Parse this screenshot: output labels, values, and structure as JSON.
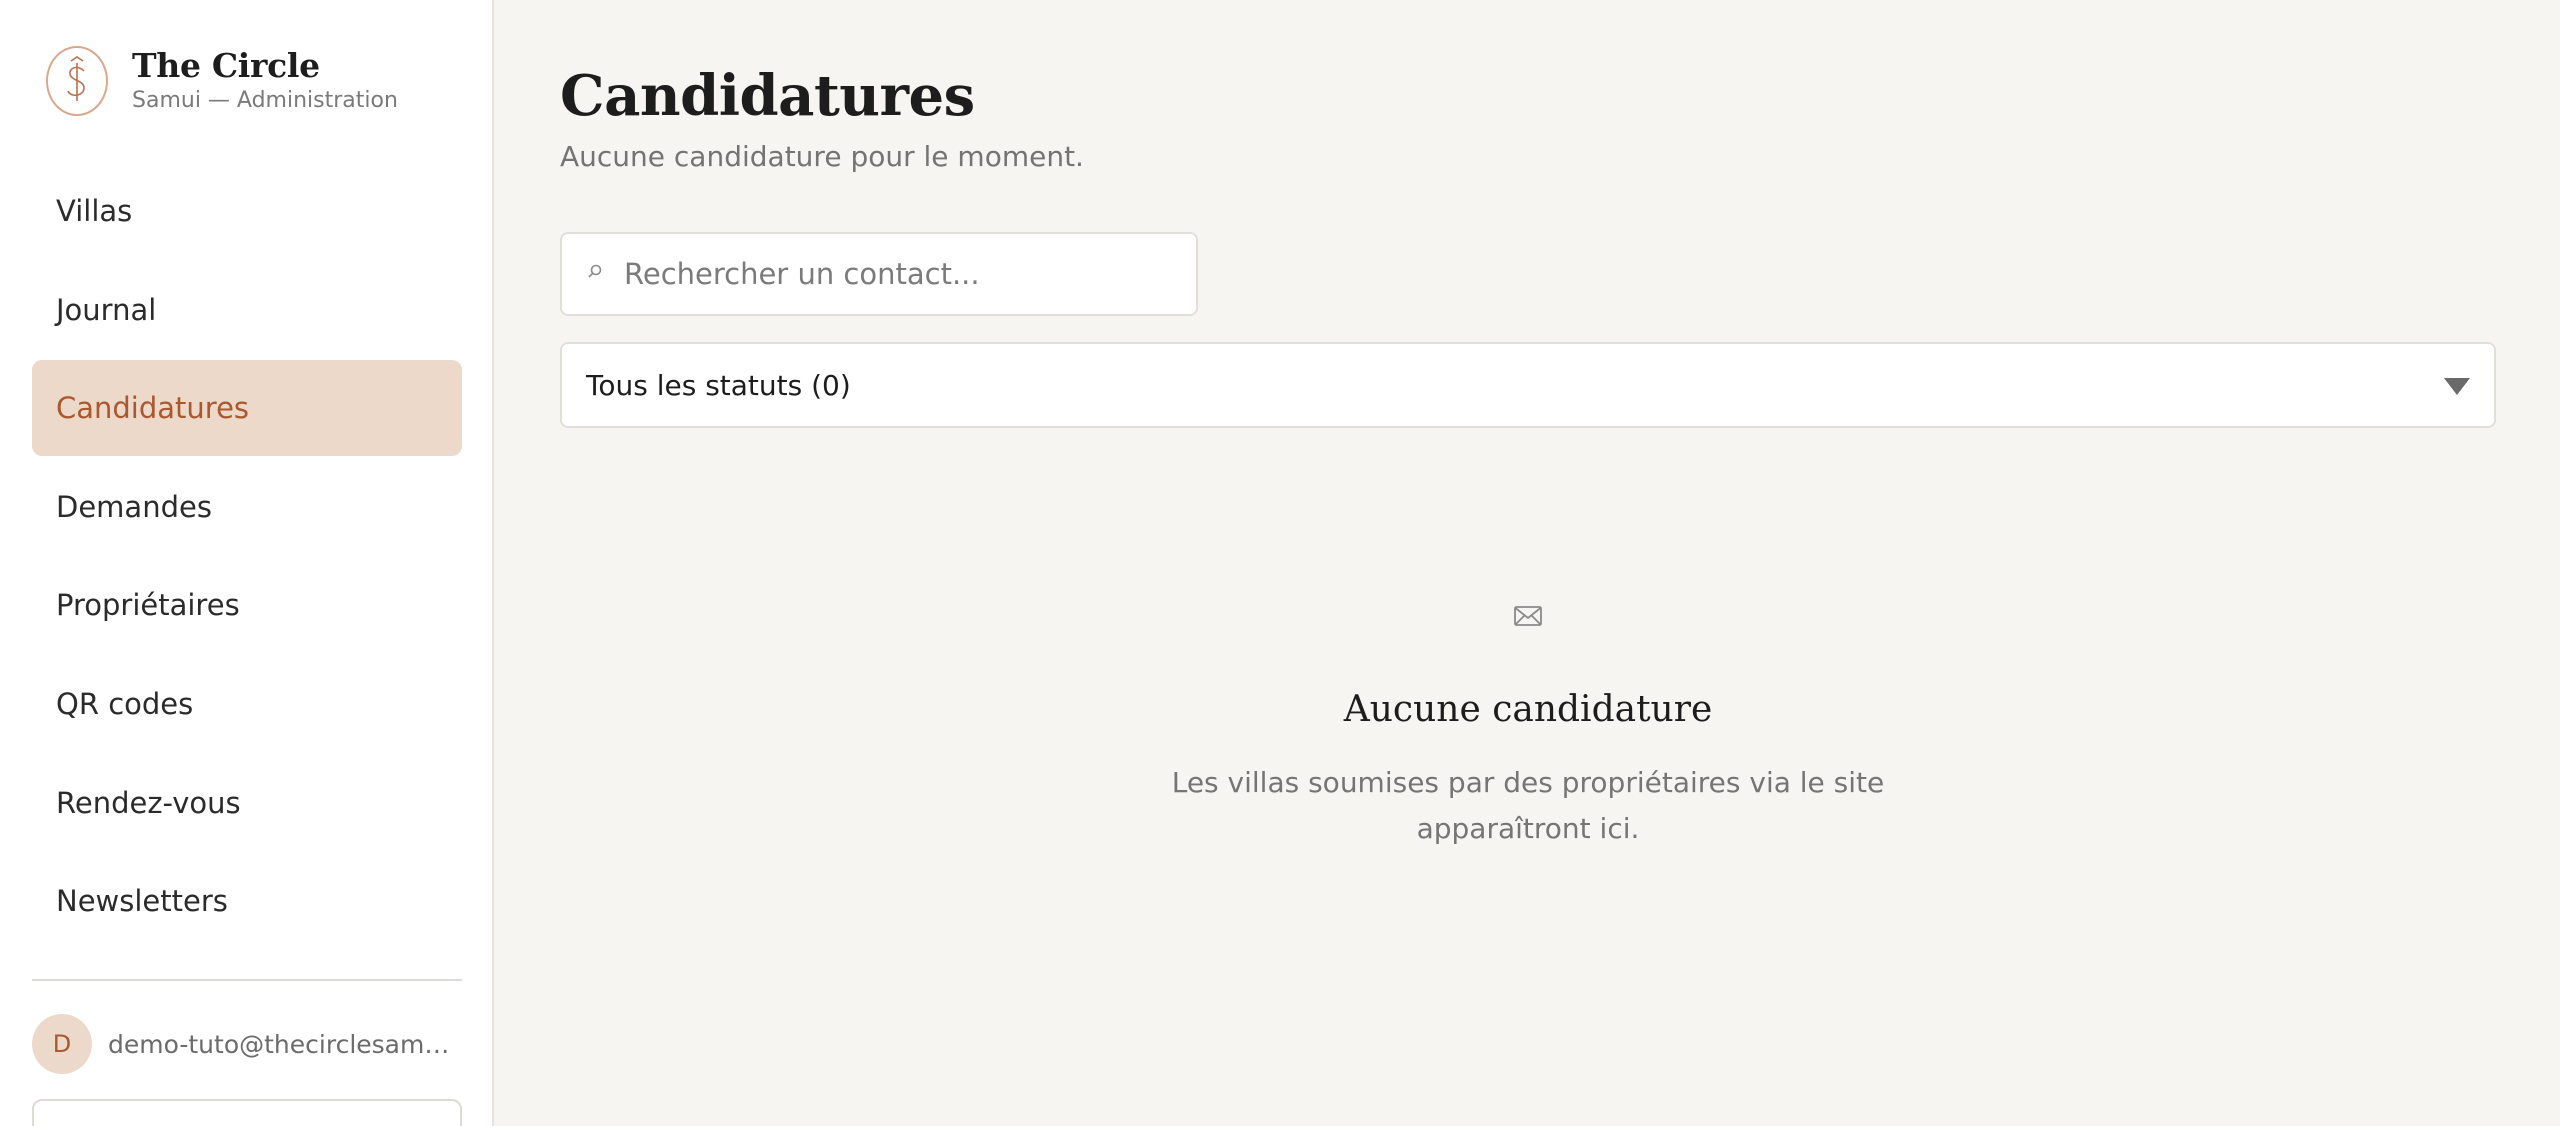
{
  "brand": {
    "title": "The Circle",
    "subtitle": "Samui — Administration"
  },
  "sidebar": {
    "items": [
      {
        "label": "Villas"
      },
      {
        "label": "Journal"
      },
      {
        "label": "Candidatures",
        "active": true
      },
      {
        "label": "Demandes"
      },
      {
        "label": "Propriétaires"
      },
      {
        "label": "QR codes"
      },
      {
        "label": "Rendez-vous"
      },
      {
        "label": "Newsletters"
      }
    ],
    "user": {
      "initial": "D",
      "email": "demo-tuto@thecirclesamui.com"
    }
  },
  "main": {
    "title": "Candidatures",
    "subtitle": "Aucune candidature pour le moment.",
    "search": {
      "icon": "search-icon",
      "placeholder": "Rechercher un contact..."
    },
    "status_filter": {
      "selected": "Tous les statuts (0)"
    },
    "empty_state": {
      "icon": "envelope-icon",
      "title": "Aucune candidature",
      "text": "Les villas soumises par des propriétaires via le site apparaîtront ici."
    }
  },
  "colors": {
    "accent": "#a9582f",
    "active_bg": "#ecd9ca",
    "background": "#f6f5f2"
  }
}
